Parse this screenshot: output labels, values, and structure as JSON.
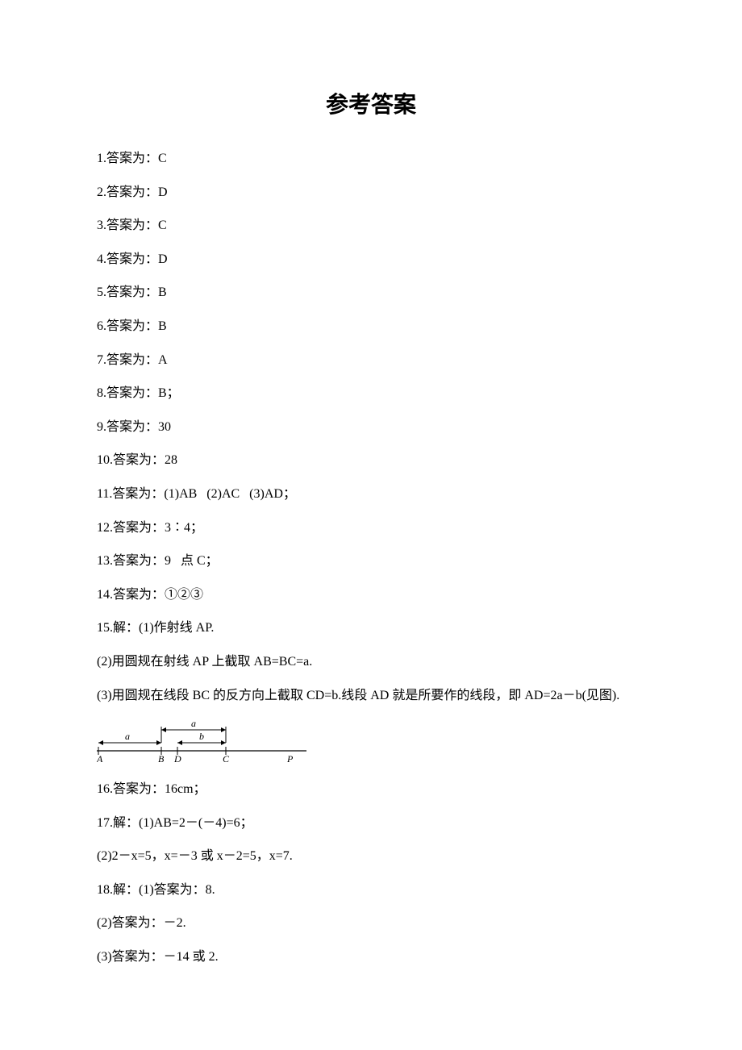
{
  "title": "参考答案",
  "answers": {
    "a1": "1.答案为：C",
    "a2": "2.答案为：D",
    "a3": "3.答案为：C",
    "a4": "4.答案为：D",
    "a5": "5.答案为：B",
    "a6": "6.答案为：B",
    "a7": "7.答案为：A",
    "a8": "8.答案为：B；",
    "a9": "9.答案为：30",
    "a10": "10.答案为：28",
    "a11": "11.答案为：(1)AB   (2)AC   (3)AD；",
    "a12": "12.答案为：3∶4；",
    "a13": "13.答案为：9   点 C；",
    "a14": "14.答案为：①②③",
    "a15_1": "15.解：(1)作射线 AP.",
    "a15_2": "(2)用圆规在射线 AP 上截取 AB=BC=a.",
    "a15_3": "(3)用圆规在线段 BC 的反方向上截取 CD=b.线段 AD 就是所要作的线段，即 AD=2a－b(见图).",
    "a16": "16.答案为：16cm；",
    "a17_1": "17.解：(1)AB=2－(－4)=6；",
    "a17_2": "(2)2－x=5，x=－3 或 x－2=5，x=7.",
    "a18_1": "18.解：(1)答案为：8.",
    "a18_2": "(2)答案为：－2.",
    "a18_3": "(3)答案为：－14 或 2."
  },
  "diagram": {
    "label_a_top": "a",
    "label_b": "b",
    "A": "A",
    "B": "B",
    "D": "D",
    "C": "C",
    "P": "P"
  }
}
